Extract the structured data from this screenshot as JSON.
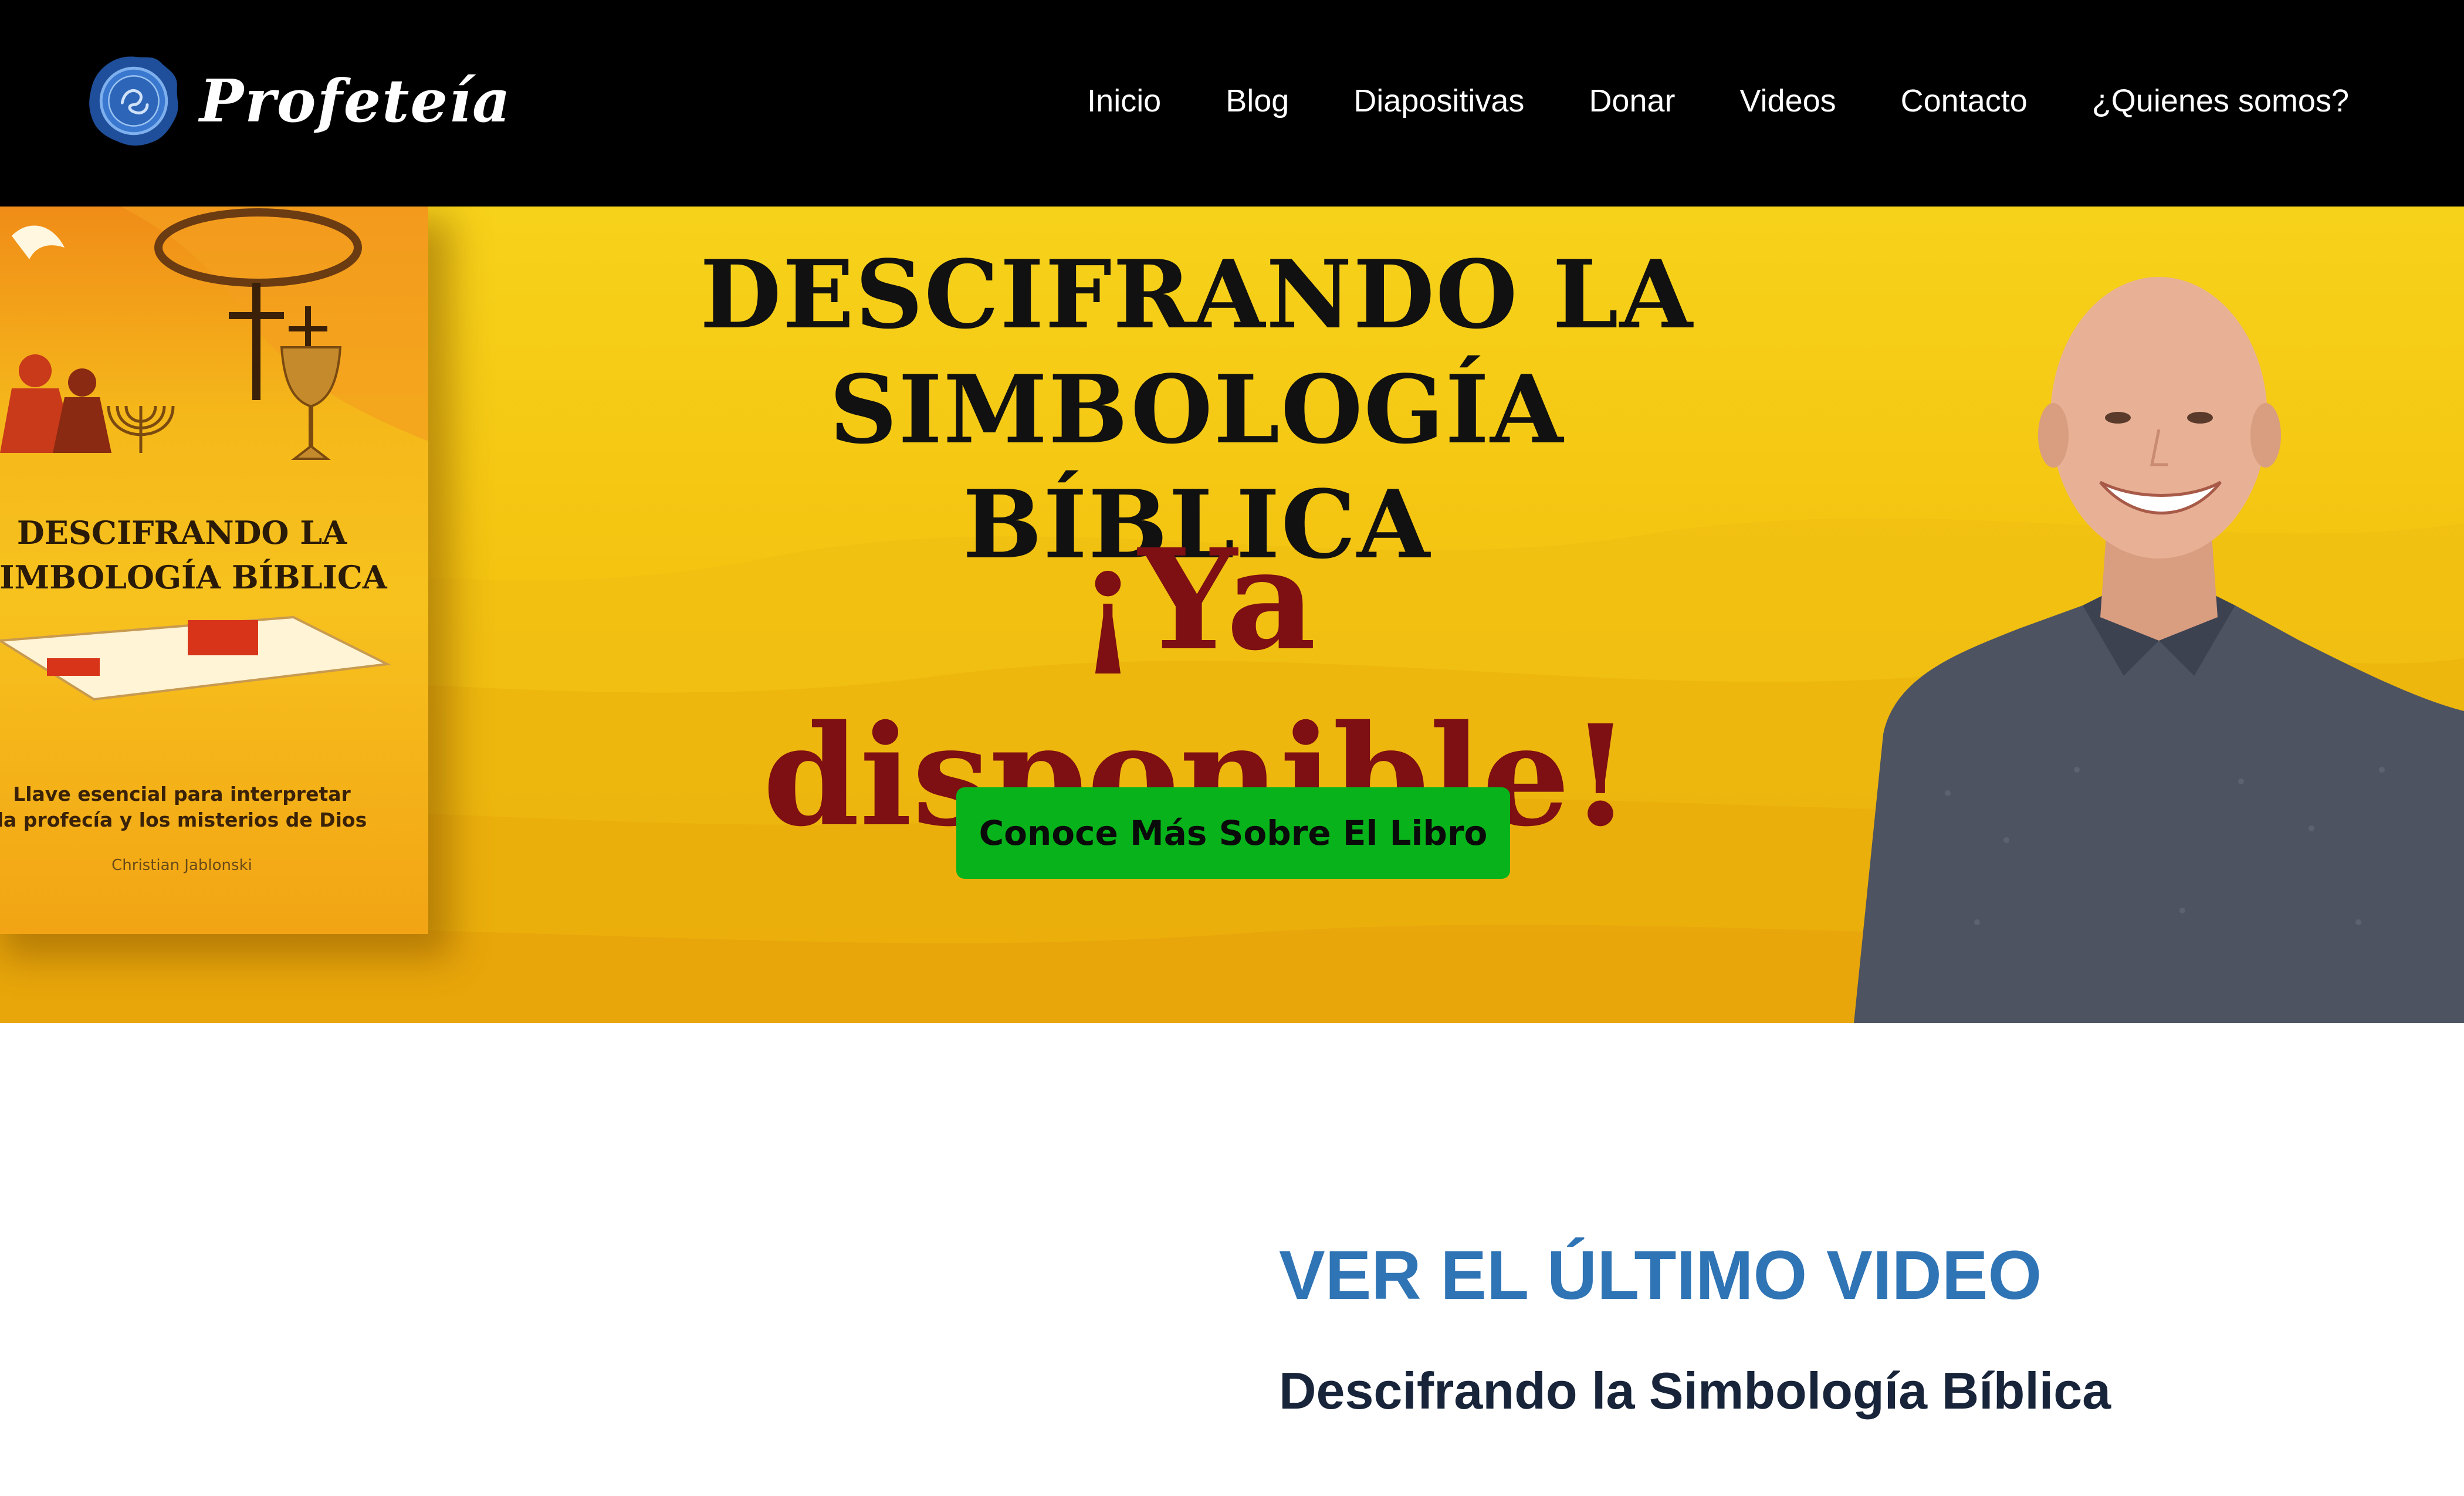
{
  "brand": {
    "name": "Profeteía",
    "logo_icon": "wax-seal-icon",
    "accent": "#2f6fc4"
  },
  "nav": {
    "items": [
      {
        "label": "Inicio"
      },
      {
        "label": "Blog"
      },
      {
        "label": "Diapositivas"
      },
      {
        "label": "Donar"
      },
      {
        "label": "Videos"
      },
      {
        "label": "Contacto"
      },
      {
        "label": "¿Quienes somos?"
      }
    ]
  },
  "hero": {
    "title_line1": "DESCIFRANDO LA",
    "title_line2": "SIMBOLOGÍA BÍBLICA",
    "subtitle": "¡Ya disponible!",
    "cta_label": "Conoce Más Sobre El Libro",
    "book": {
      "title_line1": "DESCIFRANDO LA",
      "title_line2": "SIMBOLOGÍA BÍBLICA",
      "subtitle_line1": "Llave esencial para interpretar",
      "subtitle_line2": "la profecía y  los misterios de Dios",
      "author": "Christian Jablonski"
    },
    "colors": {
      "background": "#f4c411",
      "subtitle": "#7e0f12",
      "cta": "#08b21b"
    }
  },
  "latest": {
    "heading": "VER EL ÚLTIMO VIDEO",
    "video_title": "Descifrando la Simbología Bíblica",
    "heading_color": "#2f74b5"
  }
}
